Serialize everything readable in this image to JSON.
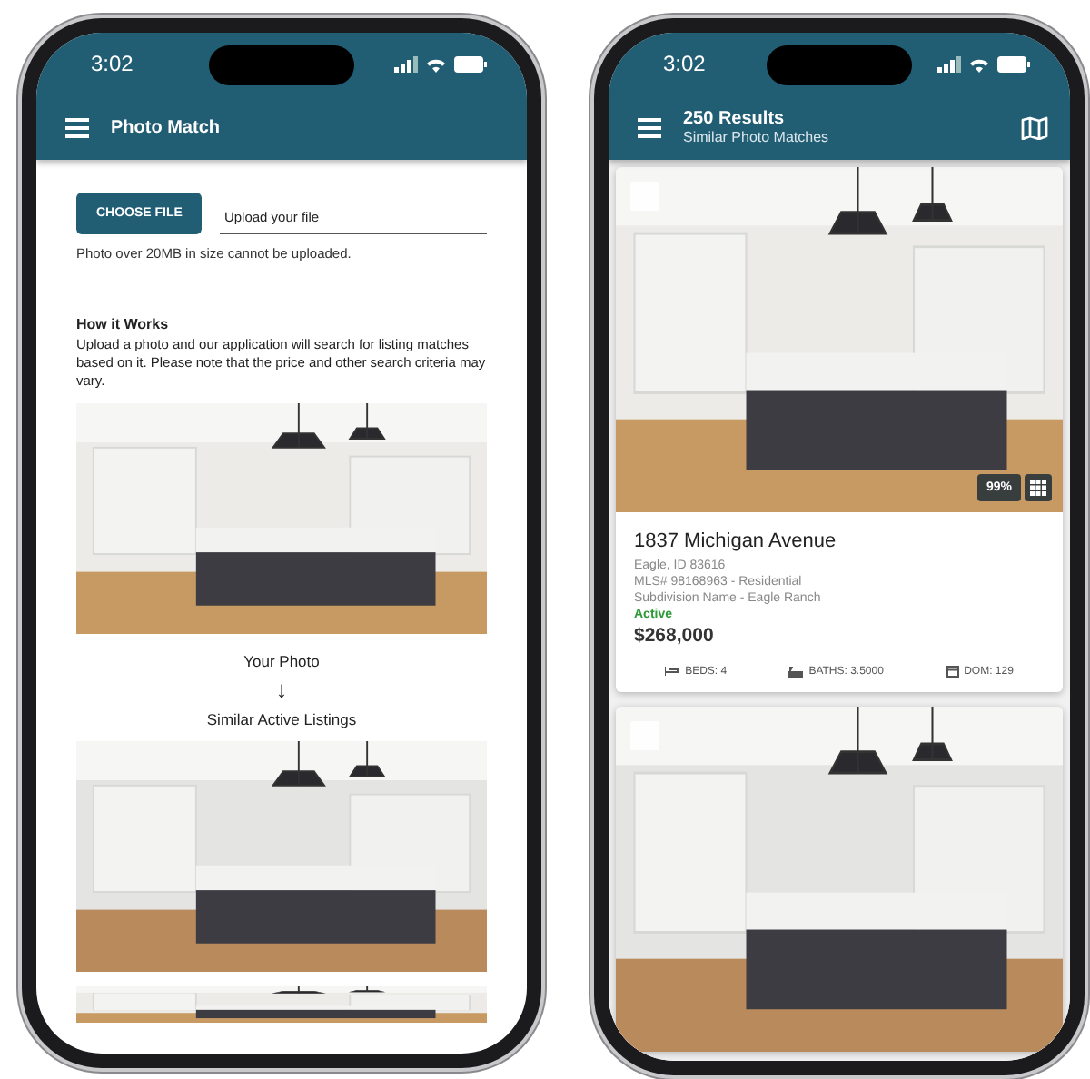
{
  "left_phone": {
    "status_time": "3:02",
    "app_bar": {
      "title": "Photo Match"
    },
    "upload": {
      "button": "CHOOSE FILE",
      "placeholder": "Upload your file",
      "note": "Photo over 20MB in size cannot be uploaded."
    },
    "how_it_works": {
      "heading": "How it Works",
      "text": "Upload a photo and our application will search for listing matches based on it. Please note that the price and other search criteria may vary."
    },
    "your_photo_caption": "Your Photo",
    "arrow": "↓",
    "similar_caption": "Similar Active Listings"
  },
  "right_phone": {
    "status_time": "3:02",
    "app_bar": {
      "title": "250 Results",
      "subtitle": "Similar Photo Matches"
    },
    "listings": [
      {
        "selected": false,
        "match": "99%",
        "address": "1837 Michigan Avenue",
        "city": "Eagle, ID 83616",
        "mls": "MLS# 98168963 - Residential",
        "subdivision": "Subdivision Name - Eagle Ranch",
        "status": "Active",
        "price": "$268,000",
        "stats": [
          {
            "kind": "beds",
            "label": "BEDS: 4"
          },
          {
            "kind": "baths",
            "label": "BATHS: 3.5000"
          },
          {
            "kind": "dom",
            "label": "DOM: 129"
          }
        ]
      },
      {
        "selected": false
      }
    ]
  }
}
